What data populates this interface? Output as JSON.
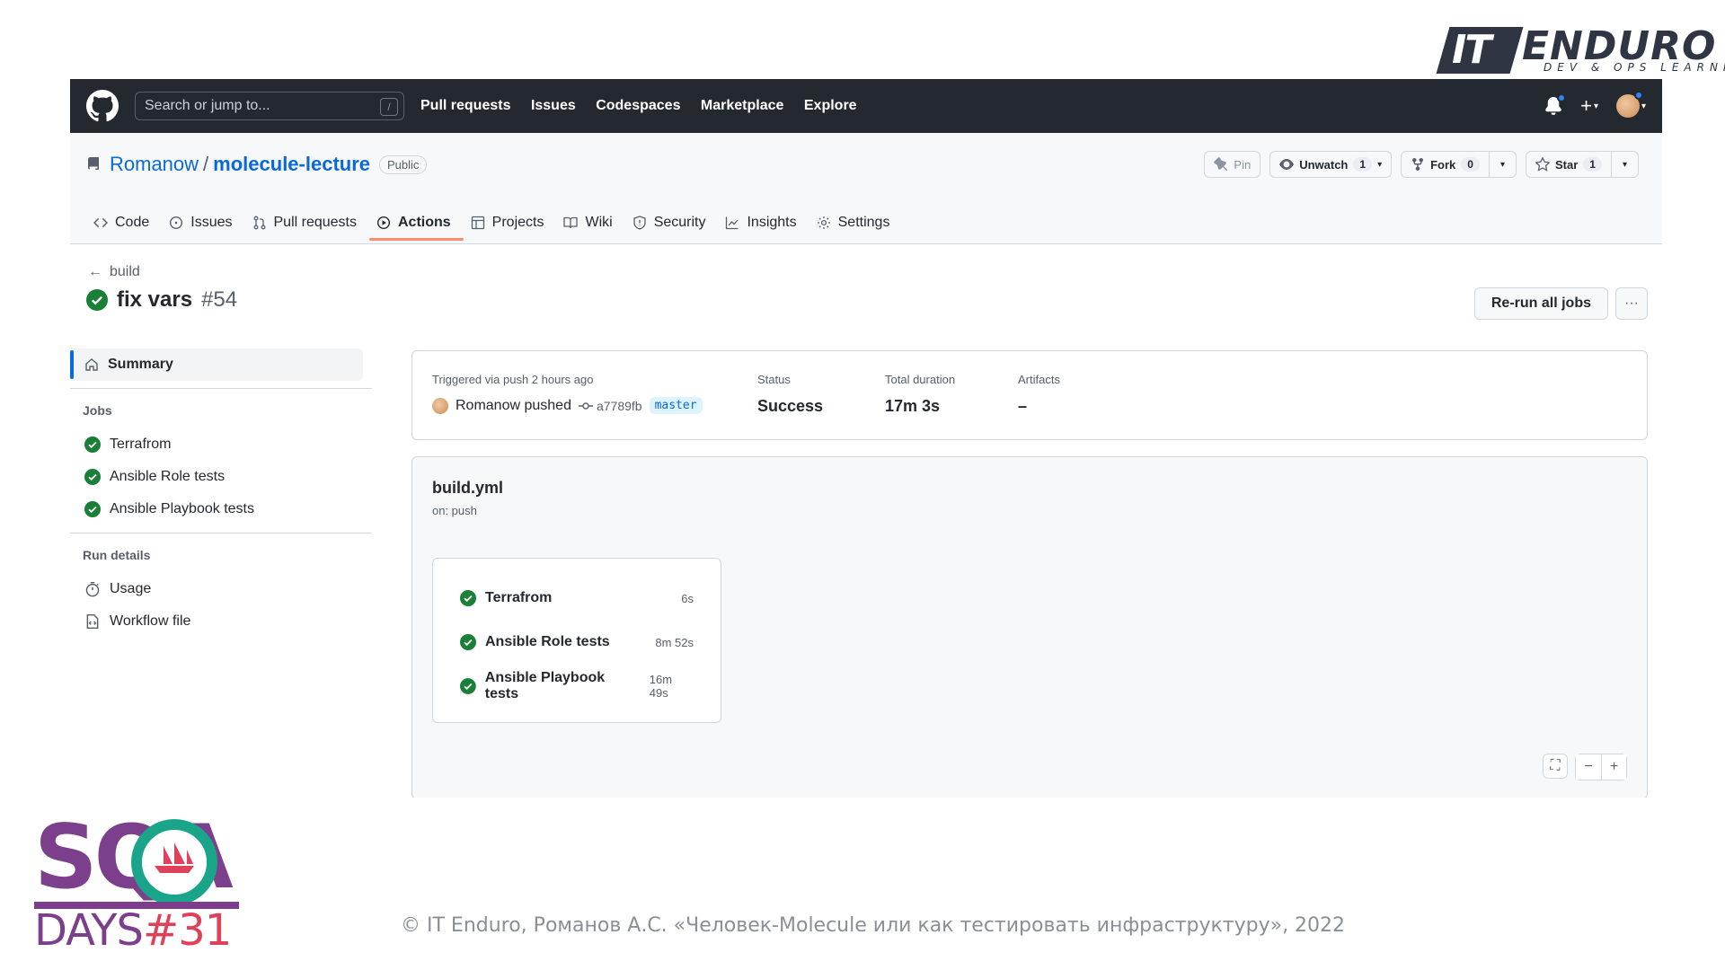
{
  "slide": {
    "brand_top": {
      "mark": "IT",
      "word": "ENDURO",
      "tagline": "DEV & OPS LEARNING"
    },
    "conference": {
      "word": "SQA",
      "days": "DAYS",
      "number": "#31"
    },
    "footer": "© IT Enduro, Романов А.С. «Человек-Molecule или как тестировать инфраструктуру», 2022"
  },
  "header": {
    "search_placeholder": "Search or jump to...",
    "search_shortcut": "/",
    "nav": [
      "Pull requests",
      "Issues",
      "Codespaces",
      "Marketplace",
      "Explore"
    ]
  },
  "repo": {
    "owner": "Romanow",
    "separator": "/",
    "name": "molecule-lecture",
    "visibility": "Public",
    "actions": {
      "pin": "Pin",
      "unwatch": "Unwatch",
      "unwatch_count": "1",
      "fork": "Fork",
      "fork_count": "0",
      "star": "Star",
      "star_count": "1"
    },
    "tabs": [
      {
        "label": "Code",
        "icon": "code-icon"
      },
      {
        "label": "Issues",
        "icon": "issue-icon"
      },
      {
        "label": "Pull requests",
        "icon": "pull-request-icon"
      },
      {
        "label": "Actions",
        "icon": "play-icon",
        "active": true
      },
      {
        "label": "Projects",
        "icon": "table-icon"
      },
      {
        "label": "Wiki",
        "icon": "book-icon"
      },
      {
        "label": "Security",
        "icon": "shield-icon"
      },
      {
        "label": "Insights",
        "icon": "graph-icon"
      },
      {
        "label": "Settings",
        "icon": "gear-icon"
      }
    ]
  },
  "run": {
    "back_label": "build",
    "title": "fix vars",
    "number": "#54",
    "rerun_label": "Re-run all jobs"
  },
  "sidebar": {
    "summary": "Summary",
    "jobs_heading": "Jobs",
    "jobs": [
      "Terrafrom",
      "Ansible Role tests",
      "Ansible Playbook tests"
    ],
    "details_heading": "Run details",
    "details": [
      "Usage",
      "Workflow file"
    ]
  },
  "summary": {
    "trigger_label": "Triggered via push 2 hours ago",
    "pusher": "Romanow pushed",
    "sha": "a7789fb",
    "branch": "master",
    "status_label": "Status",
    "status_value": "Success",
    "duration_label": "Total duration",
    "duration_value": "17m 3s",
    "artifacts_label": "Artifacts",
    "artifacts_value": "–"
  },
  "workflow": {
    "file": "build.yml",
    "on": "on: push",
    "jobs": [
      {
        "name": "Terrafrom",
        "duration": "6s"
      },
      {
        "name": "Ansible Role tests",
        "duration": "8m 52s"
      },
      {
        "name": "Ansible Playbook tests",
        "duration": "16m 49s"
      }
    ]
  },
  "colors": {
    "success": "#1a7f37",
    "link": "#0969da",
    "header_bg": "#24292f",
    "tab_underline": "#fd8c73"
  }
}
